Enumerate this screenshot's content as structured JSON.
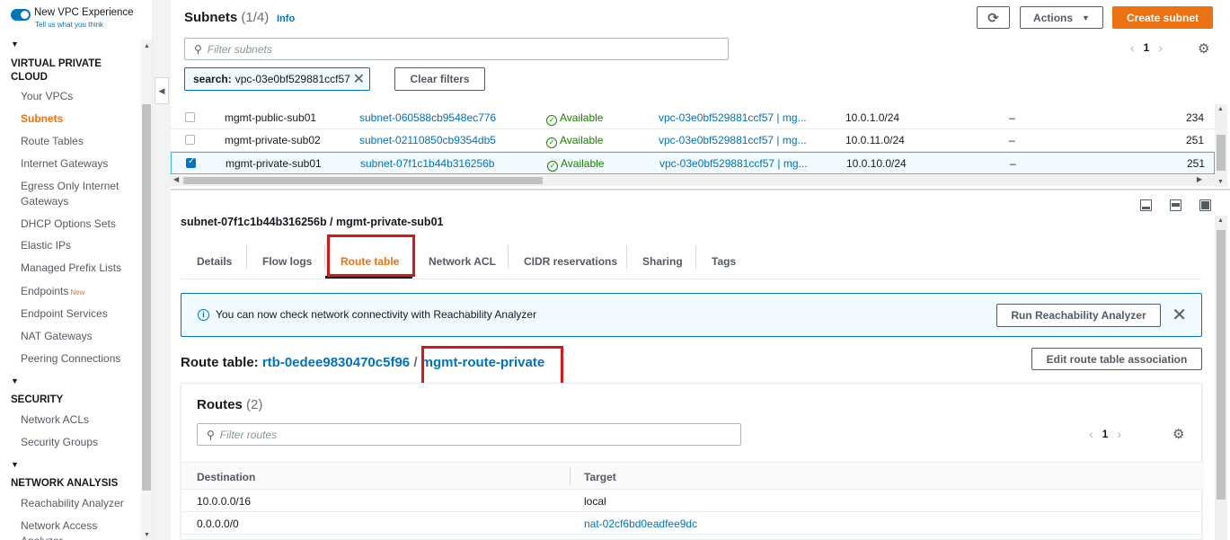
{
  "sidebar": {
    "toggle_label": "New VPC Experience",
    "toggle_sublabel": "Tell us what you think",
    "sections": [
      {
        "title": "VIRTUAL PRIVATE CLOUD"
      },
      {
        "title": "SECURITY"
      },
      {
        "title": "NETWORK ANALYSIS"
      }
    ],
    "vpc_items": [
      "Your VPCs",
      "Subnets",
      "Route Tables",
      "Internet Gateways",
      "Egress Only Internet Gateways",
      "DHCP Options Sets",
      "Elastic IPs",
      "Managed Prefix Lists",
      "Endpoints",
      "Endpoint Services",
      "NAT Gateways",
      "Peering Connections"
    ],
    "new_badge": "New",
    "security_items": [
      "Network ACLs",
      "Security Groups"
    ],
    "analysis_items": [
      "Reachability Analyzer",
      "Network Access Analyzer"
    ]
  },
  "subnets": {
    "title": "Subnets",
    "count": "(1/4)",
    "info": "Info",
    "actions_label": "Actions",
    "create_label": "Create subnet",
    "filter_placeholder": "Filter subnets",
    "token_key": "search:",
    "token_value": "vpc-03e0bf529881ccf57",
    "clear_filters": "Clear filters",
    "page": "1",
    "rows": [
      {
        "name": "mgmt-public-sub01",
        "id": "subnet-060588cb9548ec776",
        "state": "Available",
        "vpc": "vpc-03e0bf529881ccf57 | mg...",
        "cidr": "10.0.1.0/24",
        "ipv6": "–",
        "ips": "234",
        "selected": false
      },
      {
        "name": "mgmt-private-sub02",
        "id": "subnet-02110850cb9354db5",
        "state": "Available",
        "vpc": "vpc-03e0bf529881ccf57 | mg...",
        "cidr": "10.0.11.0/24",
        "ipv6": "–",
        "ips": "251",
        "selected": false
      },
      {
        "name": "mgmt-private-sub01",
        "id": "subnet-07f1c1b44b316256b",
        "state": "Available",
        "vpc": "vpc-03e0bf529881ccf57 | mg...",
        "cidr": "10.0.10.0/24",
        "ipv6": "–",
        "ips": "251",
        "selected": true
      }
    ]
  },
  "detail": {
    "title": "subnet-07f1c1b44b316256b / mgmt-private-sub01",
    "tabs": [
      "Details",
      "Flow logs",
      "Route table",
      "Network ACL",
      "CIDR reservations",
      "Sharing",
      "Tags"
    ],
    "active_tab": "Route table",
    "alert_text": "You can now check network connectivity with Reachability Analyzer",
    "run_analyzer": "Run Reachability Analyzer",
    "rt_prefix": "Route table:",
    "rt_id": "rtb-0edee9830470c5f96",
    "rt_sep": "/",
    "rt_name": "mgmt-route-private",
    "edit_assoc": "Edit route table association",
    "routes_title": "Routes",
    "routes_count": "(2)",
    "routes_filter_placeholder": "Filter routes",
    "routes_page": "1",
    "col_destination": "Destination",
    "col_target": "Target",
    "routes": [
      {
        "destination": "10.0.0.0/16",
        "target": "local",
        "target_is_link": false
      },
      {
        "destination": "0.0.0.0/0",
        "target": "nat-02cf6bd0eadfee9dc",
        "target_is_link": true
      }
    ]
  },
  "colors": {
    "accent": "#ec7211",
    "link": "#0073bb",
    "highlight": "#d91515",
    "success": "#1d8102"
  }
}
